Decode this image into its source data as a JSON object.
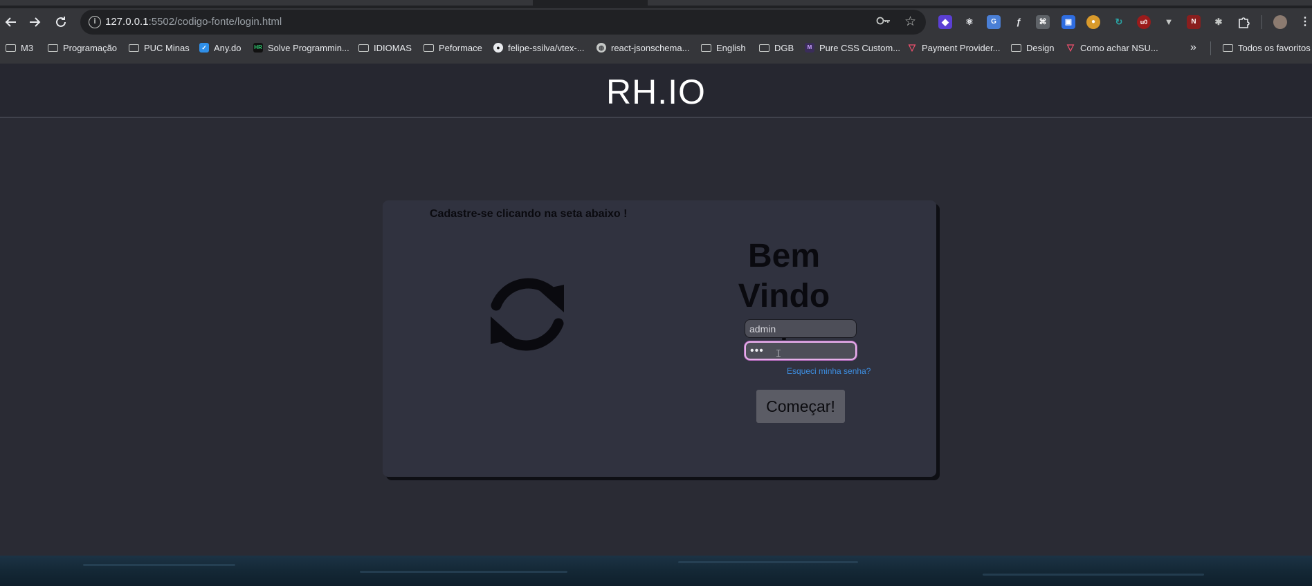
{
  "browser": {
    "url_host": "127.0.0.1",
    "url_path": ":5502/codigo-fonte/login.html",
    "bookmarks": [
      {
        "label": "M3",
        "kind": "folder"
      },
      {
        "label": "Programação",
        "kind": "folder"
      },
      {
        "label": "PUC Minas",
        "kind": "folder"
      },
      {
        "label": "Any.do",
        "kind": "site"
      },
      {
        "label": "Solve Programmin...",
        "kind": "site"
      },
      {
        "label": "IDIOMAS",
        "kind": "folder"
      },
      {
        "label": "Peformace",
        "kind": "folder"
      },
      {
        "label": "felipe-ssilva/vtex-...",
        "kind": "site"
      },
      {
        "label": "react-jsonschema...",
        "kind": "site"
      },
      {
        "label": "English",
        "kind": "folder"
      },
      {
        "label": "DGB",
        "kind": "folder"
      },
      {
        "label": "Pure CSS Custom...",
        "kind": "site"
      },
      {
        "label": "Payment Provider...",
        "kind": "site"
      },
      {
        "label": "Design",
        "kind": "folder"
      },
      {
        "label": "Como achar NSU...",
        "kind": "site"
      }
    ],
    "overflow_label": "»",
    "all_bookmarks_label": "Todos os favoritos"
  },
  "page": {
    "brand": "RH.IO",
    "hint": "Cadastre-se clicando na seta abaixo !",
    "welcome": "Bem Vindo !",
    "username_value": "admin",
    "password_mask": "•••",
    "forgot_link": "Esqueci minha senha?",
    "submit_label": "Começar!"
  },
  "colors": {
    "page_bg": "#2a2b34",
    "card_bg": "#30323f",
    "link": "#3d8ee0",
    "focus_ring": "#e6b0ea"
  }
}
